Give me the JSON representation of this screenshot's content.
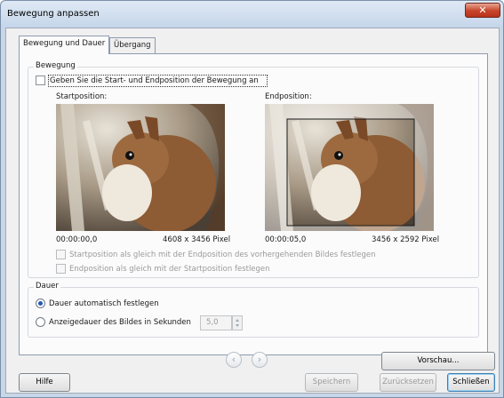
{
  "window": {
    "title": "Bewegung anpassen",
    "close_glyph": "✕"
  },
  "tabs": [
    {
      "label": "Bewegung und Dauer",
      "active": true
    },
    {
      "label": "Übergang",
      "active": false
    }
  ],
  "movement": {
    "legend": "Bewegung",
    "specify_checkbox_label": "Geben Sie die Start- und Endposition der Bewegung an",
    "specify_checked": false,
    "start_label": "Startposition:",
    "end_label": "Endposition:",
    "start_time": "00:00:00,0",
    "start_size": "4608 x 3456 Pixel",
    "end_time": "00:00:05,0",
    "end_size": "3456 x 2592 Pixel",
    "option_same_as_prev_end": "Startposition als gleich mit der Endposition des vorhergehenden Bildes festlegen",
    "option_end_same_as_start": "Endposition als gleich mit der Startposition festlegen"
  },
  "duration": {
    "legend": "Dauer",
    "auto_label": "Dauer automatisch festlegen",
    "manual_label": "Anzeigedauer des Bildes in Sekunden",
    "selected": "auto",
    "seconds_value": "5,0"
  },
  "nav": {
    "prev_glyph": "‹",
    "next_glyph": "›"
  },
  "buttons": {
    "preview": "Vorschau...",
    "help": "Hilfe",
    "save": "Speichern",
    "reset": "Zurücksetzen",
    "close": "Schließen"
  },
  "colors": {
    "accent": "#2256b8",
    "crop_box": "#1a1a1a"
  },
  "icons": {
    "close": "close-icon",
    "prev": "chevron-left-icon",
    "next": "chevron-right-icon",
    "spin_up": "spin-up-icon",
    "spin_down": "spin-down-icon"
  }
}
